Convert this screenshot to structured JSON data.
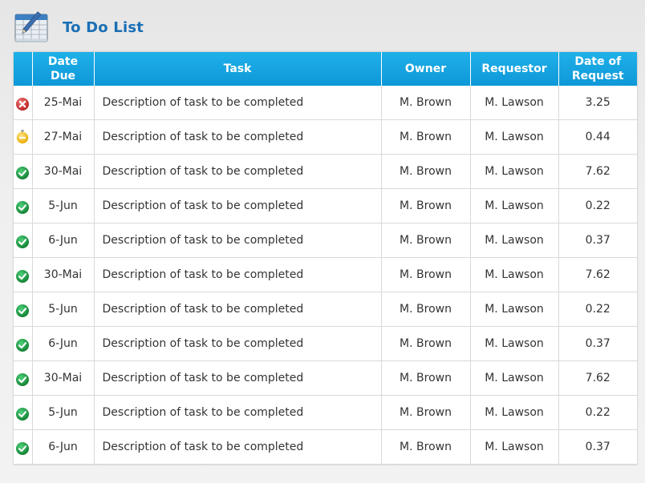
{
  "header": {
    "title": "To Do List",
    "logo_icon": "calendar-spreadsheet-icon"
  },
  "colors": {
    "header_bg": "#12a2e0",
    "title": "#1a6fb5",
    "status_error": "#c62828",
    "status_warning": "#f0b400",
    "status_ok": "#1e9a3d"
  },
  "table": {
    "columns": {
      "date_due": "Date Due",
      "task": "Task",
      "owner": "Owner",
      "requestor": "Requestor",
      "date_of_request": "Date of Request"
    },
    "rows": [
      {
        "status": "error",
        "status_icon": "red-x-icon",
        "date_due": "25-Mai",
        "task": "Description of task to be completed",
        "owner": "M. Brown",
        "requestor": "M. Lawson",
        "date_of_request": "3.25"
      },
      {
        "status": "warning",
        "status_icon": "yellow-minus-icon",
        "date_due": "27-Mai",
        "task": "Description of task to be completed",
        "owner": "M. Brown",
        "requestor": "M. Lawson",
        "date_of_request": "0.44"
      },
      {
        "status": "ok",
        "status_icon": "green-check-icon",
        "date_due": "30-Mai",
        "task": "Description of task to be completed",
        "owner": "M. Brown",
        "requestor": "M. Lawson",
        "date_of_request": "7.62"
      },
      {
        "status": "ok",
        "status_icon": "green-check-icon",
        "date_due": "5-Jun",
        "task": "Description of task to be completed",
        "owner": "M. Brown",
        "requestor": "M. Lawson",
        "date_of_request": "0.22"
      },
      {
        "status": "ok",
        "status_icon": "green-check-icon",
        "date_due": "6-Jun",
        "task": "Description of task to be completed",
        "owner": "M. Brown",
        "requestor": "M. Lawson",
        "date_of_request": "0.37"
      },
      {
        "status": "ok",
        "status_icon": "green-check-icon",
        "date_due": "30-Mai",
        "task": "Description of task to be completed",
        "owner": "M. Brown",
        "requestor": "M. Lawson",
        "date_of_request": "7.62"
      },
      {
        "status": "ok",
        "status_icon": "green-check-icon",
        "date_due": "5-Jun",
        "task": "Description of task to be completed",
        "owner": "M. Brown",
        "requestor": "M. Lawson",
        "date_of_request": "0.22"
      },
      {
        "status": "ok",
        "status_icon": "green-check-icon",
        "date_due": "6-Jun",
        "task": "Description of task to be completed",
        "owner": "M. Brown",
        "requestor": "M. Lawson",
        "date_of_request": "0.37"
      },
      {
        "status": "ok",
        "status_icon": "green-check-icon",
        "date_due": "30-Mai",
        "task": "Description of task to be completed",
        "owner": "M. Brown",
        "requestor": "M. Lawson",
        "date_of_request": "7.62"
      },
      {
        "status": "ok",
        "status_icon": "green-check-icon",
        "date_due": "5-Jun",
        "task": "Description of task to be completed",
        "owner": "M. Brown",
        "requestor": "M. Lawson",
        "date_of_request": "0.22"
      },
      {
        "status": "ok",
        "status_icon": "green-check-icon",
        "date_due": "6-Jun",
        "task": "Description of task to be completed",
        "owner": "M. Brown",
        "requestor": "M. Lawson",
        "date_of_request": "0.37"
      }
    ]
  }
}
